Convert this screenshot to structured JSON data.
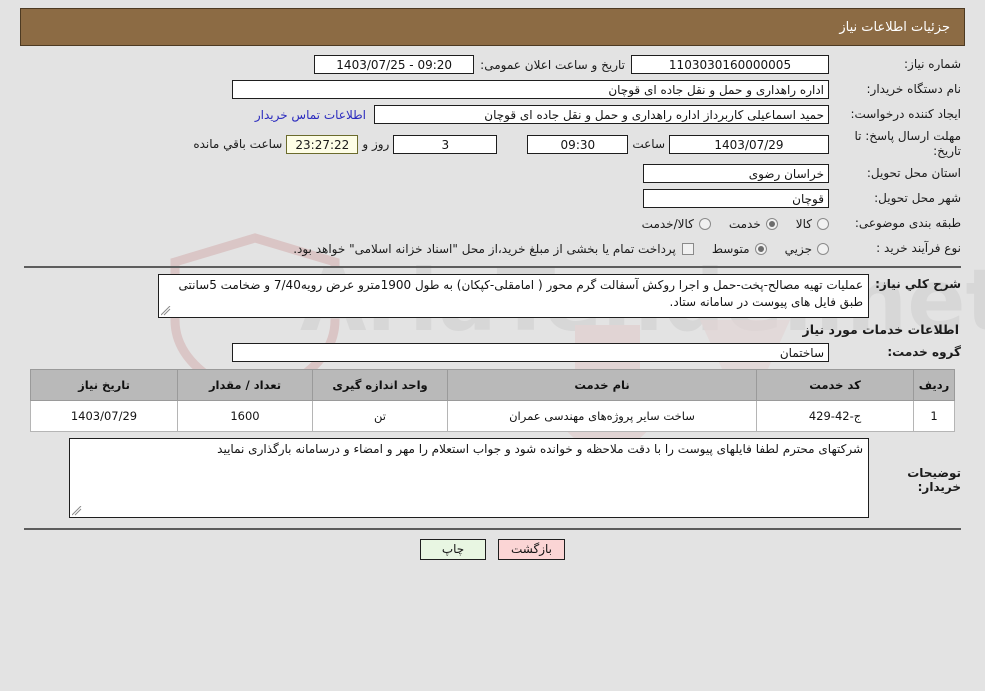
{
  "header": {
    "title": "جزئیات اطلاعات نیاز"
  },
  "form": {
    "need_number": {
      "label": "شماره نیاز:",
      "value": "1103030160000005"
    },
    "announce": {
      "label": "تاریخ و ساعت اعلان عمومی:",
      "value": "09:20 - 1403/07/25"
    },
    "buyer_org": {
      "label": "نام دستگاه خریدار:",
      "value": "اداره راهداری و حمل و نقل جاده ای قوچان"
    },
    "creator": {
      "label": "ایجاد کننده درخواست:",
      "value": "حمید اسماعیلی کاربرداز اداره راهداری و حمل و نقل جاده ای قوچان"
    },
    "contact_link": "اطلاعات تماس خریدار",
    "deadline": {
      "label": "مهلت ارسال پاسخ: تا تاریخ:",
      "date": "1403/07/29",
      "time_label": "ساعت",
      "time": "09:30",
      "days": "3",
      "days_label": "روز و",
      "countdown": "23:27:22",
      "countdown_label": "ساعت باقي مانده"
    },
    "province": {
      "label": "استان محل تحویل:",
      "value": "خراسان رضوی"
    },
    "city": {
      "label": "شهر محل تحویل:",
      "value": "قوچان"
    },
    "category": {
      "label": "طبقه بندی موضوعی:",
      "options": [
        {
          "label": "کالا",
          "selected": false
        },
        {
          "label": "خدمت",
          "selected": true
        },
        {
          "label": "کالا/خدمت",
          "selected": false
        }
      ]
    },
    "purchase_type": {
      "label": "نوع فرآیند خرید :",
      "options": [
        {
          "label": "جزیي",
          "selected": false
        },
        {
          "label": "متوسط",
          "selected": true
        }
      ],
      "treasury_checkbox": {
        "checked": false,
        "text": "پرداخت تمام یا بخشی از مبلغ خرید،از محل \"اسناد خزانه اسلامی\" خواهد بود."
      }
    }
  },
  "need_description": {
    "label": "شرح کلي نیاز:",
    "value": "عملیات تهیه مصالح-پخت-حمل و اجرا روکش آسفالت گرم محور ( امامقلی-کپکان) به طول 1900مترو عرض رویه7/40 و ضخامت 5سانتی طبق فایل های پیوست در سامانه ستاد."
  },
  "services_section": {
    "heading": "اطلاعات خدمات مورد نیاز",
    "service_group": {
      "label": "گروه خدمت:",
      "value": "ساختمان"
    },
    "table": {
      "columns": [
        "ردیف",
        "کد خدمت",
        "نام خدمت",
        "واحد اندازه گیری",
        "تعداد / مقدار",
        "تاریخ نیاز"
      ],
      "rows": [
        {
          "radif": "1",
          "code": "ج-42-429",
          "name": "ساخت سایر پروژه‌های مهندسی عمران",
          "unit": "تن",
          "qty": "1600",
          "date": "1403/07/29"
        }
      ]
    }
  },
  "buyer_notes": {
    "label": "توضیحات خریدار:",
    "value": "شرکتهای محترم لطفا فایلهای پیوست را با دقت ملاحظه و خوانده شود و جواب استعلام را مهر و امضاء و درسامانه بارگذاری نمایید"
  },
  "footer": {
    "back_label": "بازگشت",
    "print_label": "چاپ"
  },
  "colors": {
    "header_bar": "#8c6b44",
    "page_bg": "#e3e3e3",
    "link": "#2b2bbe",
    "table_header": "#b9b9b9",
    "countdown_bg": "#fdfde6",
    "back_button": "#fbd5d5",
    "print_button": "#e8f6e2"
  },
  "watermark": {
    "text": "AriaTender.net"
  }
}
